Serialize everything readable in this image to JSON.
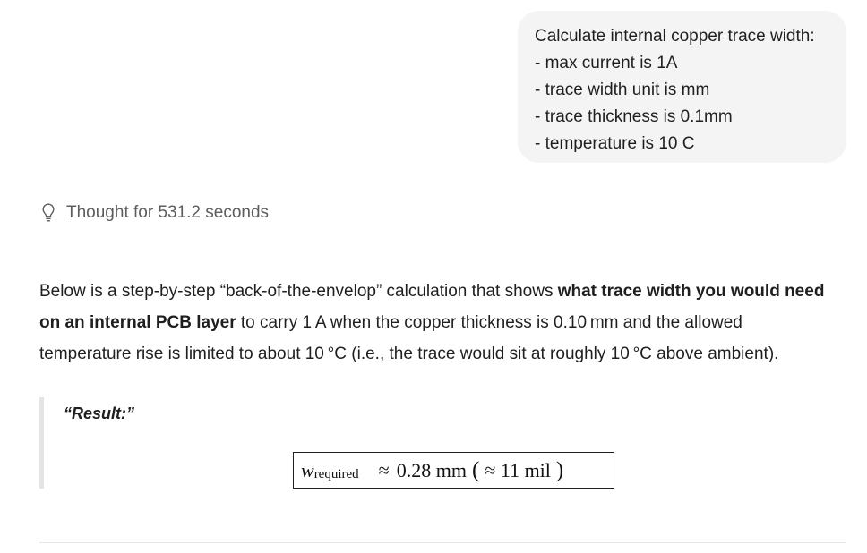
{
  "user_message": {
    "lines": [
      "Calculate internal copper trace width:",
      "- max current is 1A",
      "- trace width unit is mm",
      "- trace thickness is 0.1mm",
      "- temperature is 10 C"
    ]
  },
  "thought": {
    "icon": "lightbulb-icon",
    "label": "Thought for 531.2 seconds"
  },
  "answer": {
    "paragraph": {
      "part1": "Below is a step-by-step “back-of-the-envelop” calculation that shows ",
      "bold": "what trace width you would need on an internal PCB layer",
      "part2": " to carry 1 A when the copper thickness is 0.10 mm and the allowed temperature rise is limited to about 10 °C (i.e., the trace would sit at roughly 10 °C above ambient)."
    },
    "quote_label": "“Result:”",
    "formula": {
      "variable": "w",
      "subscript": "required",
      "approx1": "≈",
      "value": "0.28 mm",
      "open_paren": "(",
      "approx2": "≈",
      "alt_value": "11 mil",
      "close_paren": ")"
    }
  },
  "colors": {
    "bubble_bg": "#f4f4f4",
    "text": "#1f1f1f",
    "muted_text": "#5d5d5d",
    "quote_border": "#e4e4e4"
  }
}
